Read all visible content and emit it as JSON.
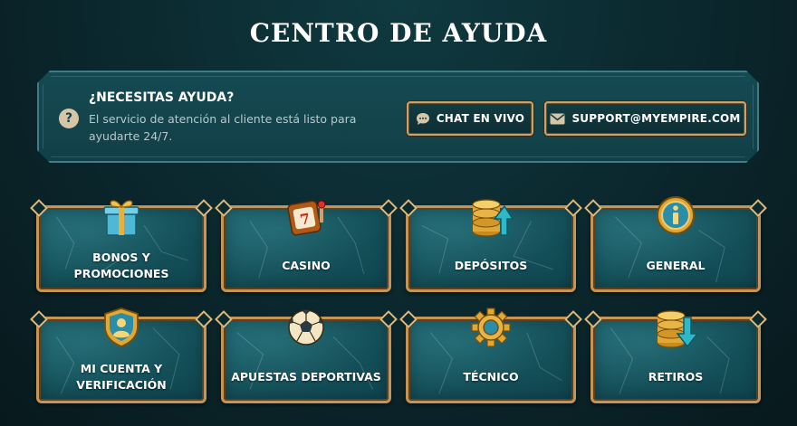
{
  "page": {
    "title": "CENTRO DE AYUDA"
  },
  "help": {
    "title": "¿NECESITAS AYUDA?",
    "description": "El servicio de atención al cliente está listo para ayudarte 24/7.",
    "chat_label": "CHAT EN VIVO",
    "email_label": "SUPPORT@MYEMPIRE.COM"
  },
  "categories": [
    {
      "label": "BONOS Y PROMOCIONES",
      "icon": "gift-icon"
    },
    {
      "label": "CASINO",
      "icon": "slot-machine-icon"
    },
    {
      "label": "DEPÓSITOS",
      "icon": "coins-up-arrow-icon"
    },
    {
      "label": "GENERAL",
      "icon": "info-icon"
    },
    {
      "label": "MI CUENTA Y VERIFICACIÓN",
      "icon": "user-shield-icon"
    },
    {
      "label": "APUESTAS DEPORTIVAS",
      "icon": "soccer-ball-icon"
    },
    {
      "label": "TÉCNICO",
      "icon": "gear-icon"
    },
    {
      "label": "RETIROS",
      "icon": "coins-down-arrow-icon"
    }
  ],
  "colors": {
    "gold_border": "#c49557",
    "card_teal": "#15525b",
    "panel_teal": "#154a52",
    "background": "#0b2a30"
  }
}
